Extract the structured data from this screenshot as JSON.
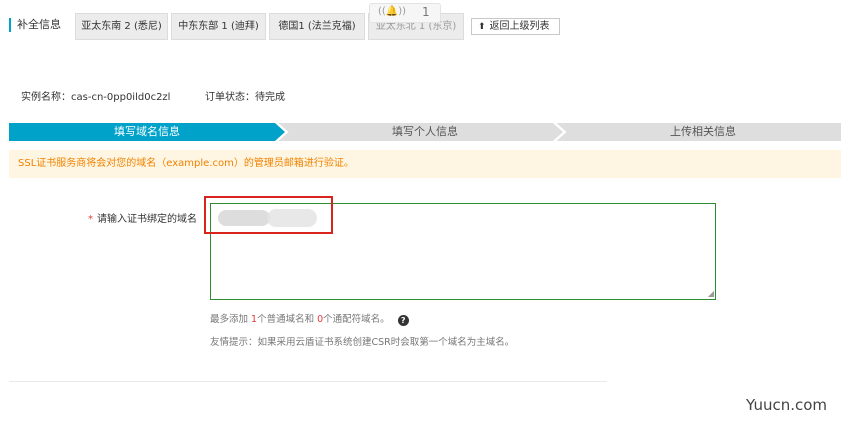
{
  "header": {
    "title": "补全信息",
    "regions": [
      "亚太东南 2 (悉尼)",
      "中东东部 1 (迪拜)",
      "德国1 (法兰克福)",
      "亚太东北 1 (东京)"
    ],
    "notification_count": "1",
    "back_label": "返回上级列表"
  },
  "info": {
    "instance_label": "实例名称：cas-cn-0pp0ild0c2zl",
    "order_status": "订单状态：待完成"
  },
  "steps": [
    "填写域名信息",
    "填写个人信息",
    "上传相关信息"
  ],
  "notice": "SSL证书服务商将会对您的域名（example.com）的管理员邮箱进行验证。",
  "form": {
    "required_mark": "*",
    "domain_label": "请输入证书绑定的域名",
    "hint_prefix": "最多添加 ",
    "hint_common_count": "1",
    "hint_middle": "个普通域名和 ",
    "hint_wildcard_count": "0",
    "hint_suffix": "个通配符域名。",
    "tip": "友情提示：如果采用云盾证书系统创建CSR时会取第一个域名为主域名。"
  },
  "watermark": "Yuucn.com",
  "colors": {
    "accent": "#00a2ca",
    "step_inactive": "#dedede",
    "notice_bg": "#fef6e3",
    "notice_text": "#f08200",
    "highlight": "#d9231d",
    "input_border": "#2e8b2e"
  },
  "icons": {
    "notification": "bell-icon",
    "back": "up-arrow-icon",
    "help": "question-circle-icon"
  }
}
